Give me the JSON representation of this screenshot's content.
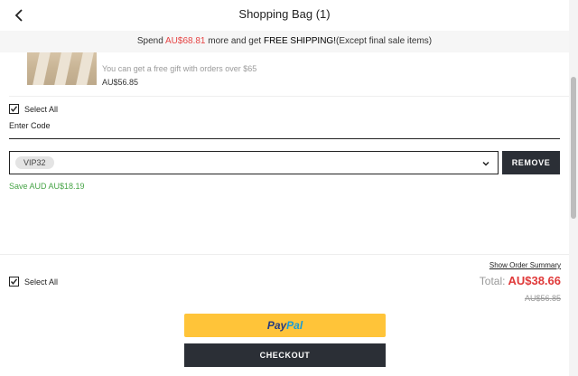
{
  "header": {
    "title": "Shopping Bag (1)",
    "back_icon": "chevron-left-icon"
  },
  "banner": {
    "prefix": "Spend ",
    "amount": "AU$68.81",
    "middle": " more and get ",
    "highlight": "FREE SHIPPING!",
    "suffix": "(Except final sale items)"
  },
  "product": {
    "gift_text": "You can get a free gift with orders over $65",
    "price": "AU$56.85"
  },
  "select_all_top": {
    "label": "Select All",
    "checked": true
  },
  "coupon": {
    "heading": "Enter Code",
    "selected_code": "VIP32",
    "dropdown_icon": "chevron-down-icon",
    "remove_label": "REMOVE",
    "save_text": "Save AUD AU$18.19"
  },
  "summary": {
    "link": "Show Order Summary",
    "total_label": "Total:",
    "total_amount": "AU$38.66",
    "original_amount": "AU$56.85"
  },
  "select_all_bottom": {
    "label": "Select All",
    "checked": true
  },
  "paypal": {
    "part1": "Pay",
    "part2": "Pal"
  },
  "checkout": {
    "label": "CHECKOUT"
  },
  "colors": {
    "accent_red": "#e03a3a",
    "save_green": "#47a447",
    "paypal_yellow": "#ffc439",
    "dark_button": "#2b2f36"
  }
}
